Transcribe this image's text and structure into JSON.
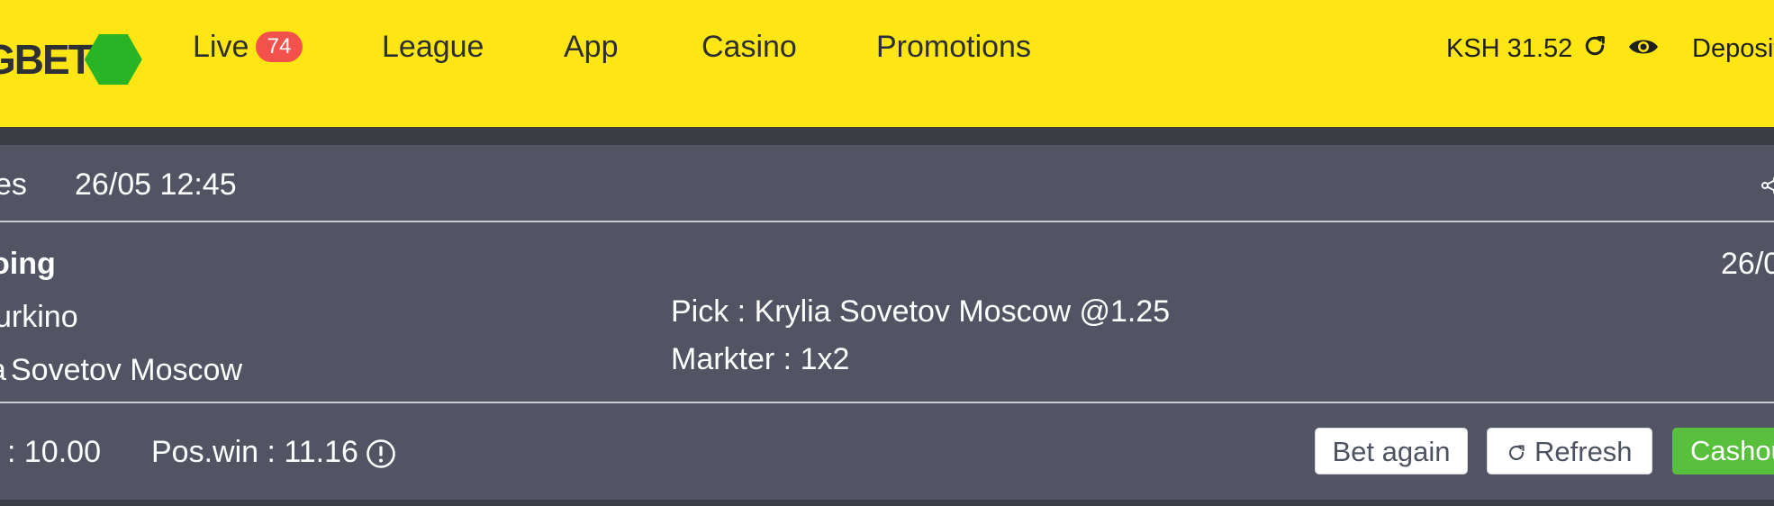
{
  "header": {
    "logo_text": "GBET",
    "nav": {
      "live": "Live",
      "live_count": "74",
      "league": "League",
      "app": "App",
      "casino": "Casino",
      "promotions": "Promotions"
    },
    "balance": "KSH 31.52",
    "deposit": "Deposit",
    "icons": [
      "refresh-icon",
      "eye-icon"
    ]
  },
  "bet": {
    "type_label": "es",
    "datetime": "26/05 12:45",
    "status": "oing",
    "match_date": "26/0",
    "home_team": "urkino",
    "away_team": "Sovetov Moscow",
    "away_team_prefix": "a",
    "pick": "Pick : Krylia Sovetov Moscow @1.25",
    "market": "Markter : 1x2",
    "stake": ": 10.00",
    "pos_win": "Pos.win : 11.16",
    "buttons": {
      "bet_again": "Bet again",
      "refresh": "Refresh",
      "cashout": "Cashout"
    }
  },
  "colors": {
    "header_bg": "#fde614",
    "card_bg": "#525463",
    "badge": "#f2514c",
    "cashout": "#58c03c"
  }
}
